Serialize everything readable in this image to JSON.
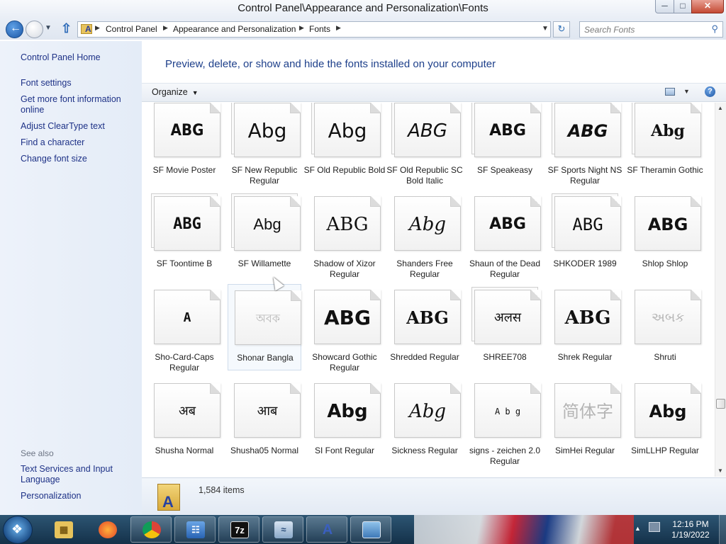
{
  "window": {
    "title": "Control Panel\\Appearance and Personalization\\Fonts",
    "min_label": "─",
    "max_label": "□",
    "close_label": "✕"
  },
  "address": {
    "crumbs": [
      "Control Panel",
      "Appearance and Personalization",
      "Fonts"
    ],
    "search_placeholder": "Search Fonts"
  },
  "left_pane": {
    "links": [
      "Control Panel Home",
      "Font settings",
      "Get more font information online",
      "Adjust ClearType text",
      "Find a character",
      "Change font size"
    ],
    "see_also_label": "See also",
    "see_also_links": [
      "Text Services and Input Language",
      "Personalization"
    ]
  },
  "main": {
    "heading": "Preview, delete, or show and hide the fonts installed on your computer",
    "organize_label": "Organize",
    "help_label": "?"
  },
  "fonts": [
    {
      "name": "SF Movie Poster",
      "sample": "ABG"
    },
    {
      "name": "SF New Republic Regular",
      "sample": "Abg"
    },
    {
      "name": "SF Old Republic Bold",
      "sample": "Abg"
    },
    {
      "name": "SF Old Republic SC Bold Italic",
      "sample": "ABG"
    },
    {
      "name": "SF Speakeasy",
      "sample": "ABG"
    },
    {
      "name": "SF Sports Night NS Regular",
      "sample": "ABG"
    },
    {
      "name": "SF Theramin Gothic",
      "sample": "Abg"
    },
    {
      "name": "SF Toontime B",
      "sample": "ABG"
    },
    {
      "name": "SF Willamette",
      "sample": "Abg"
    },
    {
      "name": "Shadow of Xizor Regular",
      "sample": "ABG"
    },
    {
      "name": "Shanders Free Regular",
      "sample": "Abg"
    },
    {
      "name": "Shaun of the Dead Regular",
      "sample": "ABG"
    },
    {
      "name": "SHKODER 1989",
      "sample": "ABG"
    },
    {
      "name": "Shlop Shlop",
      "sample": "ABG"
    },
    {
      "name": "Sho-Card-Caps Regular",
      "sample": "A"
    },
    {
      "name": "Shonar Bangla",
      "sample": "অবক"
    },
    {
      "name": "Showcard Gothic Regular",
      "sample": "ABG"
    },
    {
      "name": "Shredded Regular",
      "sample": "ABG"
    },
    {
      "name": "SHREE708",
      "sample": "अलस"
    },
    {
      "name": "Shrek Regular",
      "sample": "ABG"
    },
    {
      "name": "Shruti",
      "sample": "અબક"
    },
    {
      "name": "Shusha Normal",
      "sample": "अब"
    },
    {
      "name": "Shusha05 Normal",
      "sample": "आब"
    },
    {
      "name": "SI Font Regular",
      "sample": "Abg"
    },
    {
      "name": "Sickness Regular",
      "sample": "Abg"
    },
    {
      "name": "signs - zeichen 2.0 Regular",
      "sample": "A b g"
    },
    {
      "name": "SimHei Regular",
      "sample": "简体字"
    },
    {
      "name": "SimLLHP Regular",
      "sample": "Abg"
    }
  ],
  "details": {
    "item_count": "1,584 items"
  },
  "taskbar": {
    "apps": [
      "file-explorer",
      "firefox",
      "chrome",
      "control-panel",
      "7-zip",
      "resource-monitor",
      "font-viewer",
      "photo-viewer"
    ],
    "sevenzip_label": "7z",
    "time": "12:16 PM",
    "date": "1/19/2022"
  }
}
